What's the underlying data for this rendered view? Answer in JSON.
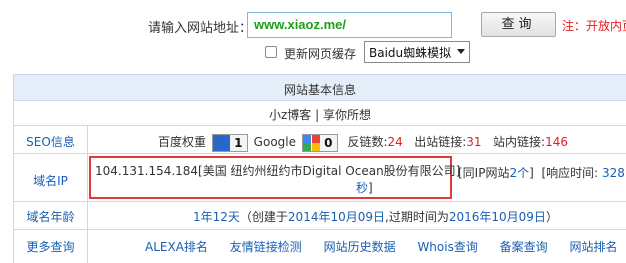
{
  "search": {
    "label": "请输入网站地址：",
    "value": "www.xiaoz.me/",
    "button": "查询",
    "notice": "注：开放内页"
  },
  "options": {
    "refresh_cache": "更新网页缓存",
    "spider": "Baidu蜘蛛模拟"
  },
  "table": {
    "title": "网站基本信息",
    "subtitle": "小z博客 | 享你所想",
    "seo": {
      "label": "SEO信息",
      "baidu_weight_label": "百度权重",
      "baidu_rank": "1",
      "google_label": "Google",
      "google_rank": "0",
      "backlinks_label": "反链数:",
      "backlinks": "24",
      "outlinks_label": "出站链接:",
      "outlinks": "31",
      "inlinks_label": "站内链接:",
      "inlinks": "146"
    },
    "domain_ip": {
      "label": "域名IP",
      "ip_text": "104.131.154.184[美国 纽约州纽约市Digital Ocean股份有限公司]",
      "same_ip_prefix": "[同IP网站",
      "same_ip_link": "2个",
      "same_ip_suffix": "]",
      "response_label": "[响应时间:",
      "response_value": "328",
      "response_unit_cont": "秒",
      "response_close": "]"
    },
    "domain_age": {
      "label": "域名年龄",
      "age": "1年12天",
      "created_prefix": "（创建于",
      "created_date": "2014年10月09日",
      "expire_prefix": ",过期时间为",
      "expire_date": "2016年10月09日",
      "close": "）"
    },
    "more": {
      "label": "更多查询",
      "links": [
        "ALEXA排名",
        "友情链接检测",
        "网站历史数据",
        "Whois查询",
        "备案查询",
        "网站排名"
      ]
    }
  }
}
